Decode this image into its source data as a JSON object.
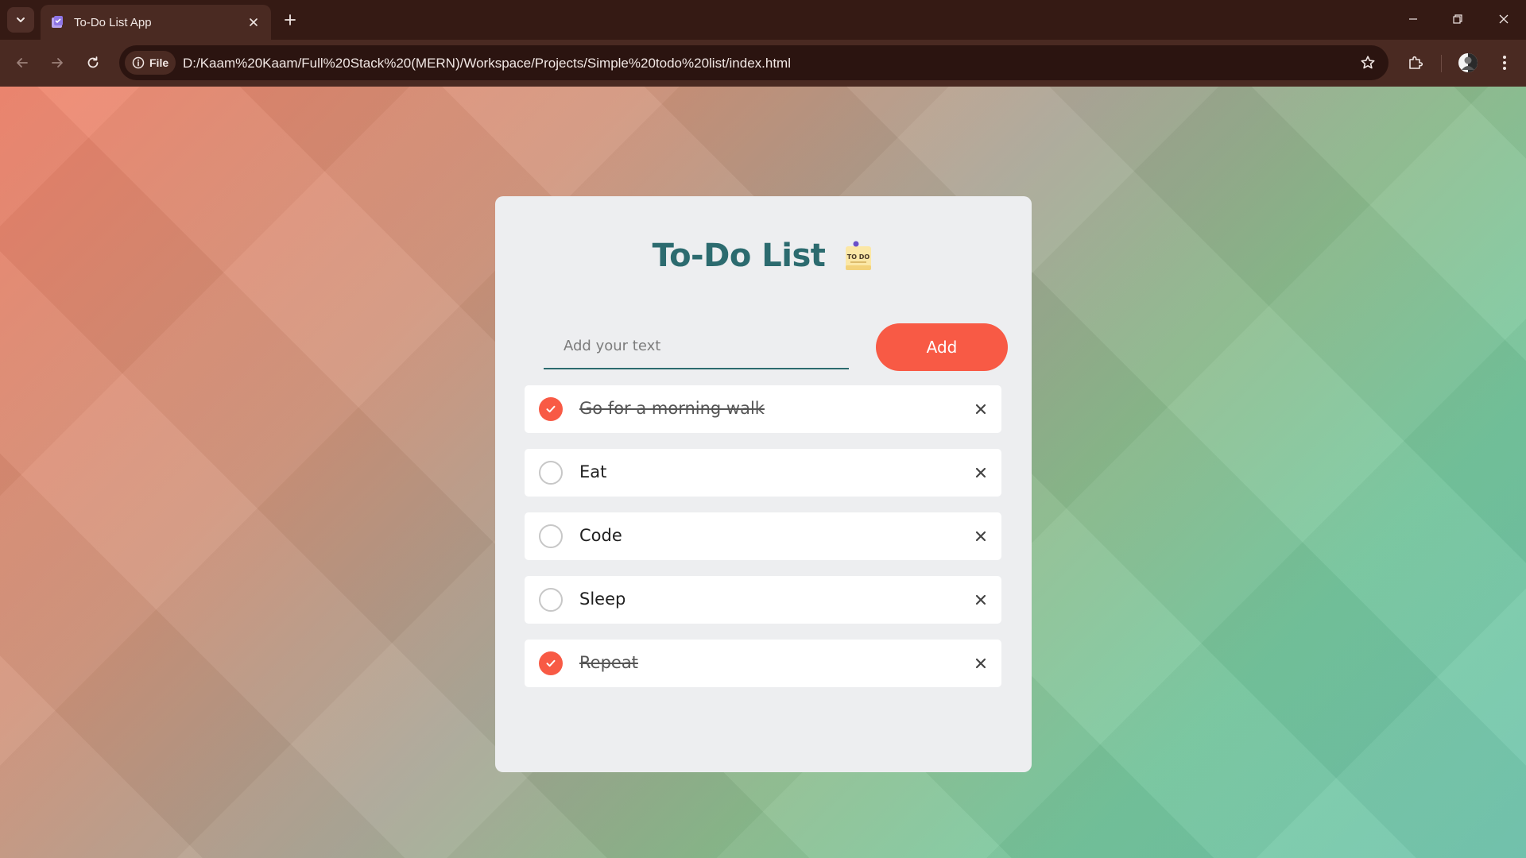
{
  "browser": {
    "tab_title": "To-Do List App",
    "site_chip_label": "File",
    "url": "D:/Kaam%20Kaam/Full%20Stack%20(MERN)/Workspace/Projects/Simple%20todo%20list/index.html",
    "icons": [
      "tab-search-icon",
      "favicon-icon",
      "close-icon",
      "plus-icon",
      "minimize-icon",
      "restore-icon",
      "close-window-icon",
      "back-icon",
      "forward-icon",
      "reload-icon",
      "info-icon",
      "star-icon",
      "extensions-icon",
      "profile-avatar",
      "menu-icon"
    ]
  },
  "app": {
    "title": "To-Do List",
    "title_icon_text": "TO DO",
    "input_placeholder": "Add your text",
    "input_value": "",
    "add_label": "Add",
    "colors": {
      "accent": "#f85a45",
      "title": "#2c6b6f",
      "card": "#edeef0"
    }
  },
  "tasks": [
    {
      "text": "Go for a morning walk",
      "done": true
    },
    {
      "text": "Eat",
      "done": false
    },
    {
      "text": "Code",
      "done": false
    },
    {
      "text": "Sleep",
      "done": false
    },
    {
      "text": "Repeat",
      "done": true
    }
  ]
}
